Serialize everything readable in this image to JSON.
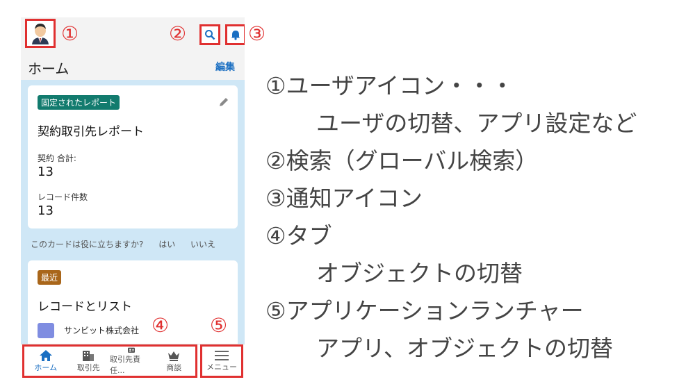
{
  "callouts": {
    "c1": "①",
    "c2": "②",
    "c3": "③",
    "c4": "④",
    "c5": "⑤"
  },
  "header": {
    "title": "ホーム",
    "edit_label": "編集"
  },
  "card1": {
    "badge": "固定されたレポート",
    "title": "契約取引先レポート",
    "metric1_label": "契約 合計:",
    "metric1_value": "13",
    "metric2_label": "レコード件数",
    "metric2_value": "13"
  },
  "feedback": {
    "question": "このカードは役に立ちますか?",
    "yes": "はい",
    "no": "いいえ"
  },
  "card2": {
    "badge": "最近",
    "title": "レコードとリスト",
    "item1": "サンビット株式会社"
  },
  "tabs": [
    {
      "label": "ホーム",
      "icon": "home-icon"
    },
    {
      "label": "取引先",
      "icon": "building-icon"
    },
    {
      "label": "取引先責任...",
      "icon": "contact-card-icon"
    },
    {
      "label": "商談",
      "icon": "crown-icon"
    }
  ],
  "menu": {
    "label": "メニュー",
    "icon": "hamburger-icon"
  },
  "explanations": [
    "①ユーザアイコン・・・",
    "ユーザの切替、アプリ設定など",
    "②検索（グローバル検索）",
    "③通知アイコン",
    "④タブ",
    "オブジェクトの切替",
    "⑤アプリケーションランチャー",
    "アプリ、オブジェクトの切替"
  ],
  "colors": {
    "annotation_red": "#e03030",
    "link_blue": "#1b6fc2",
    "badge_teal": "#127b6e",
    "badge_brown": "#a9661a",
    "content_bg": "#cfe7f6"
  }
}
